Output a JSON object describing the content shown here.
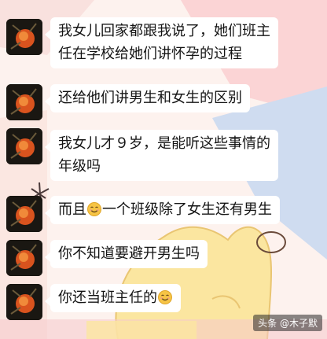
{
  "chat": {
    "messages": [
      {
        "lines": [
          "我女儿回家都跟我说了，她们班主",
          "任在学校给她们讲怀孕的过程"
        ]
      },
      {
        "lines": [
          "还给他们讲男生和女生的区别"
        ]
      },
      {
        "lines": [
          "我女儿才９岁，是能听这些事情的",
          "年级吗"
        ]
      },
      {
        "before_emoji": "而且",
        "emoji": "smile-emoji",
        "after_emoji": "一个班级除了女生还有男生"
      },
      {
        "lines": [
          "你不知道要避开男生吗"
        ]
      },
      {
        "before_emoji": "你还当班主任的",
        "emoji": "smile-emoji",
        "after_emoji": ""
      }
    ]
  },
  "watermark": {
    "text": "头条 @木子默"
  },
  "colors": {
    "background": "#fdf2ee",
    "bubble": "#ffffff",
    "wallpaper_yellow": "#fbe6a0",
    "wallpaper_blue": "#c9d8ef",
    "wallpaper_pink": "#f6c8cc"
  }
}
